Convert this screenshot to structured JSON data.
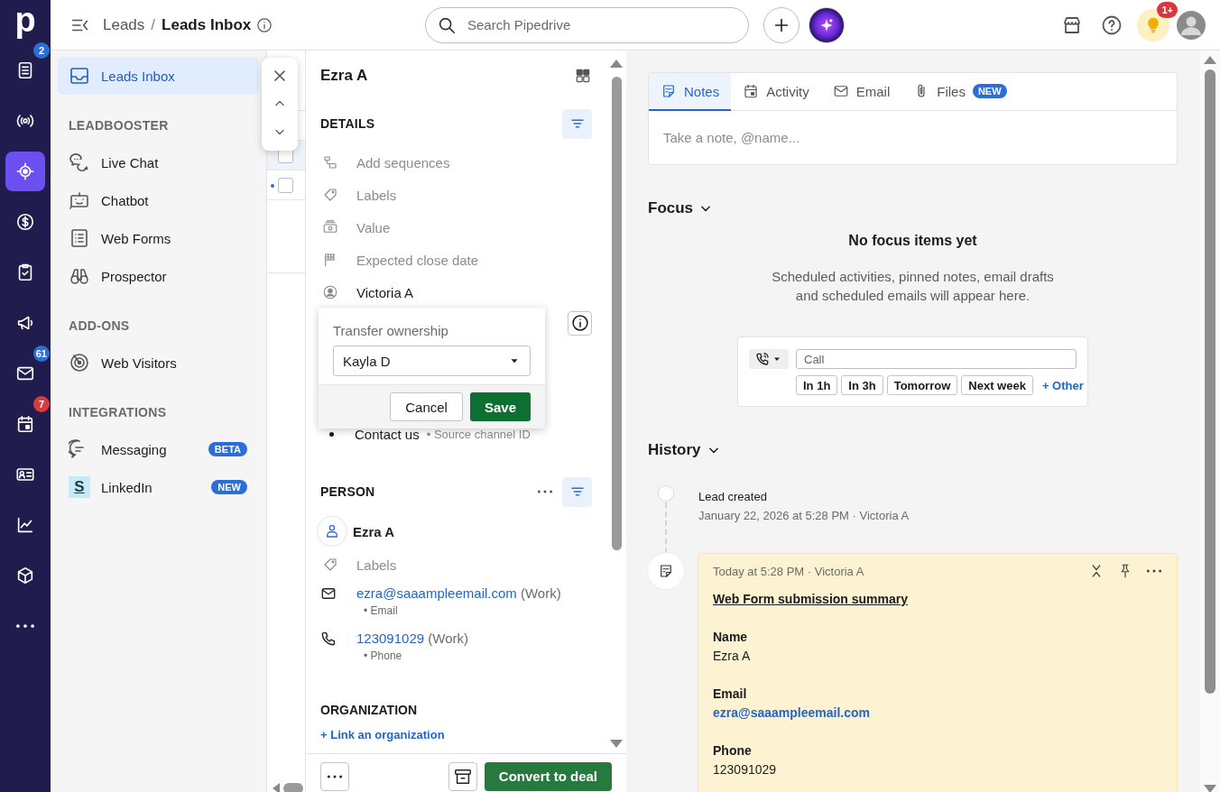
{
  "rail": {
    "logo": "p",
    "items": [
      {
        "selected": false,
        "badge": {
          "text": "2",
          "color": "#2c6ed8"
        }
      },
      {
        "selected": false
      },
      {
        "selected": true
      },
      {
        "selected": false
      },
      {
        "selected": false
      },
      {
        "selected": false
      },
      {
        "selected": false,
        "badge": {
          "text": "61",
          "color": "#2c6ed8"
        }
      },
      {
        "selected": false,
        "badge": {
          "text": "7",
          "color": "#d93a3a"
        }
      },
      {
        "selected": false
      },
      {
        "selected": false
      },
      {
        "selected": false
      },
      {
        "selected": false
      }
    ]
  },
  "topbar": {
    "breadcrumb": {
      "parent": "Leads",
      "separator": "/",
      "current": "Leads Inbox"
    },
    "search": {
      "placeholder": "Search Pipedrive"
    },
    "tips_badge": "1+"
  },
  "sidebar": {
    "sections": [
      {
        "items": [
          {
            "label": "Leads Inbox",
            "selected": true
          }
        ]
      },
      {
        "heading": "LEADBOOSTER",
        "items": [
          {
            "label": "Live Chat",
            "selected": false
          },
          {
            "label": "Chatbot",
            "selected": false
          },
          {
            "label": "Web Forms",
            "selected": false
          },
          {
            "label": "Prospector",
            "selected": false
          }
        ]
      },
      {
        "heading": "ADD-ONS",
        "items": [
          {
            "label": "Web Visitors",
            "selected": false
          }
        ]
      },
      {
        "heading": "INTEGRATIONS",
        "items": [
          {
            "label": "Messaging",
            "selected": false,
            "tag": "BETA"
          },
          {
            "label": "LinkedIn",
            "selected": false,
            "tag": "NEW",
            "logo": "S"
          }
        ]
      }
    ]
  },
  "list": {
    "rows": [
      {
        "selected": true,
        "checked": false,
        "unread": false
      },
      {
        "selected": false,
        "checked": false,
        "unread": true
      }
    ]
  },
  "detail": {
    "title": "Ezra A",
    "details": {
      "heading": "DETAILS",
      "fields": [
        {
          "label": "Add sequences",
          "filled": false
        },
        {
          "label": "Labels",
          "filled": false
        },
        {
          "label": "Value",
          "filled": false
        },
        {
          "label": "Expected close date",
          "filled": false
        },
        {
          "label": "Victoria A",
          "filled": true
        }
      ],
      "source": {
        "value": "Contact us",
        "label": "• Source channel ID"
      }
    },
    "popover": {
      "title": "Transfer ownership",
      "value": "Kayla D",
      "buttons": [
        {
          "label": "Cancel",
          "kind": "secondary"
        },
        {
          "label": "Save",
          "kind": "primary"
        }
      ]
    },
    "person": {
      "heading": "PERSON",
      "name": "Ezra A",
      "labels": "Labels",
      "email": {
        "value": "ezra@saaampleemail.com",
        "type": "(Work)",
        "label": "• Email"
      },
      "phone": {
        "value": "123091029",
        "type": "(Work)",
        "label": "• Phone"
      }
    },
    "organization": {
      "heading": "ORGANIZATION",
      "link": "+ Link an organization"
    },
    "footer": {
      "primary": "Convert to deal"
    }
  },
  "feed": {
    "tabs": [
      {
        "label": "Notes",
        "selected": true
      },
      {
        "label": "Activity",
        "selected": false
      },
      {
        "label": "Email",
        "selected": false
      },
      {
        "label": "Files",
        "selected": false,
        "badge": "NEW"
      }
    ],
    "note": {
      "placeholder": "Take a note, @name..."
    },
    "focus": {
      "title": "Focus",
      "empty_title": "No focus items yet",
      "empty_lines": [
        "Scheduled activities, pinned notes, email drafts",
        "and scheduled emails will appear here."
      ],
      "activity": {
        "placeholder": "Call",
        "quick": [
          "In 1h",
          "In 3h",
          "Tomorrow",
          "Next week"
        ],
        "other": "+ Other"
      }
    },
    "history": {
      "title": "History",
      "events": [
        {
          "kind": "event",
          "title": "Lead created",
          "meta": "January 22, 2026 at 5:28 PM · Victoria A"
        },
        {
          "kind": "note",
          "meta": "Today at 5:28 PM · Victoria A",
          "heading": "Web Form submission summary",
          "fields": [
            {
              "label": "Name",
              "value": "Ezra A",
              "link": false
            },
            {
              "label": "Email",
              "value": "ezra@saaampleemail.com",
              "link": true
            },
            {
              "label": "Phone",
              "value": "123091029",
              "link": false
            }
          ]
        }
      ]
    }
  }
}
